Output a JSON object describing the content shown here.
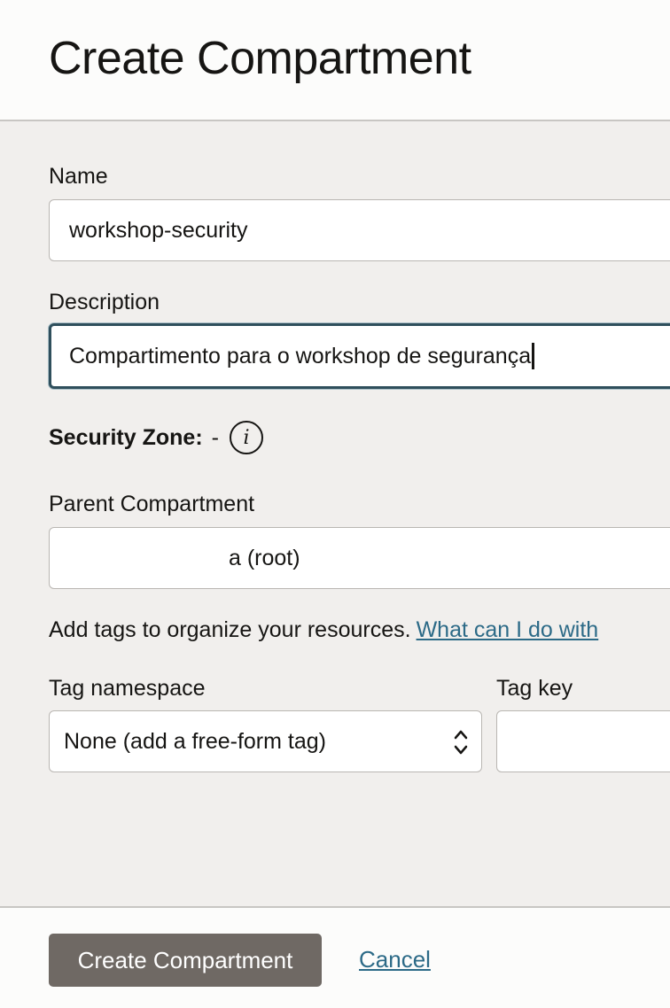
{
  "header": {
    "title": "Create Compartment"
  },
  "form": {
    "name": {
      "label": "Name",
      "value": "workshop-security"
    },
    "description": {
      "label": "Description",
      "value": "Compartimento para o workshop de segurança"
    },
    "security_zone": {
      "label": "Security Zone:",
      "value": "-",
      "icon": "info-icon"
    },
    "parent_compartment": {
      "label": "Parent Compartment",
      "value_suffix": "a (root)"
    },
    "tags": {
      "intro_text": "Add tags to organize your resources.",
      "help_link": "What can I do with",
      "namespace_label": "Tag namespace",
      "namespace_value": "None (add a free-form tag)",
      "key_label": "Tag key"
    }
  },
  "footer": {
    "create_label": "Create Compartment",
    "cancel_label": "Cancel"
  },
  "colors": {
    "primary_button": "#6f6964",
    "link": "#2c6a87",
    "focus_border": "#2f4f5c",
    "body_bg": "#f1efed"
  }
}
